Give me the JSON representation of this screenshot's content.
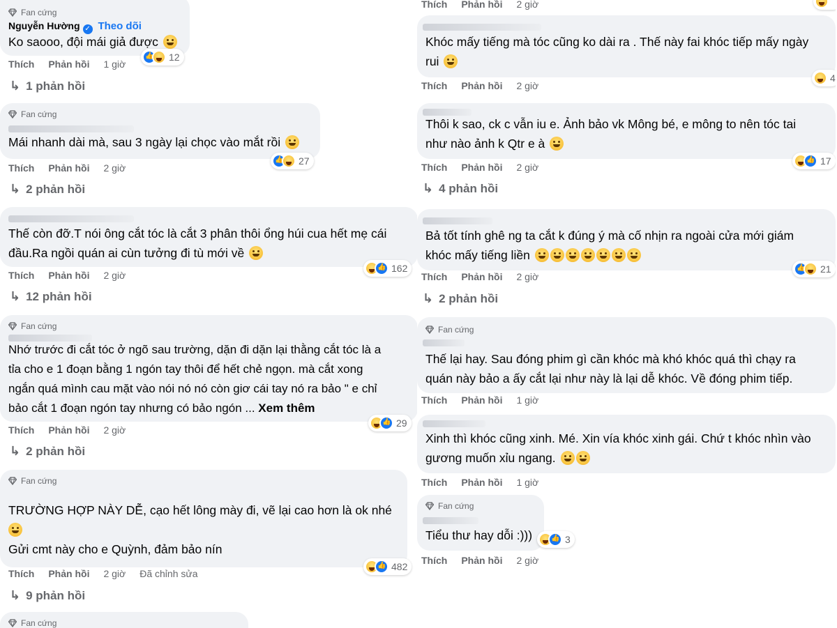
{
  "common": {
    "like": "Thích",
    "reply": "Phản hồi",
    "badge": "Fan cứng",
    "see_more": "Xem thêm",
    "follow": "Theo dõi"
  },
  "left": [
    {
      "author": "Nguyễn Hường",
      "text": "Ko saooo, đội mái giả được",
      "reactions": [
        "like",
        "haha"
      ],
      "count": "12",
      "time": "1 giờ",
      "replies": "1 phản hồi"
    },
    {
      "text": "Mái nhanh dài mà, sau 3 ngày lại chọc vào mắt rồi",
      "reactions": [
        "like",
        "haha"
      ],
      "count": "27",
      "time": "2 giờ",
      "replies": "2 phản hồi"
    },
    {
      "text_lines": [
        "Thế còn đỡ.T nói ông cắt tóc là cắt 3 phân thôi ổng húi cua hết mẹ cái",
        "đầu.Ra ngồi quán ai cùn tưởng đi tù mới về"
      ],
      "reactions": [
        "haha",
        "like"
      ],
      "count": "162",
      "time": "2 giờ",
      "replies": "12 phản hồi"
    },
    {
      "text_lines": [
        "Nhớ trước đi cắt tóc ở ngõ sau trường, dặn đi dặn lại thằng cắt tóc là a",
        "tỉa cho e 1 đoạn bằng 1 ngón tay thôi để hết chẻ ngọn. mà cắt xong",
        "ngắn quá mình cau mặt vào nói nó nó còn giơ cái tay nó ra bảo \" e chỉ",
        "bảo cắt 1 đoạn ngón tay nhưng có bảo ngón ..."
      ],
      "reactions": [
        "haha",
        "like"
      ],
      "count": "29",
      "time": "2 giờ",
      "replies": "2 phản hồi"
    },
    {
      "text_lines": [
        "TRƯỜNG HỢP NÀY DỄ, cạo hết lông mày đi, vẽ lại cao hơn là ok nhé",
        "Gửi cmt này cho e Quỳnh, đảm bảo nín"
      ],
      "reactions": [
        "haha",
        "like"
      ],
      "count": "482",
      "time": "2 giờ",
      "edited": "Đã chỉnh sửa",
      "replies": "9 phản hồi"
    }
  ],
  "right": [
    {
      "time": "2 giờ",
      "partial": true
    },
    {
      "text_lines": [
        "Khóc mấy tiếng mà tóc cũng ko dài ra . Thế này fai khóc tiếp mấy ngày",
        "rui"
      ],
      "reactions": [
        "haha"
      ],
      "count": "4",
      "time": "2 giờ"
    },
    {
      "text_lines": [
        "Thôi k sao, ck c vẫn iu e. Ảnh bảo vk Mông bé, e mông to nên tóc tai",
        "như nào ảnh k Qtr e à"
      ],
      "reactions": [
        "haha",
        "like"
      ],
      "count": "17",
      "time": "2 giờ",
      "replies": "4 phản hồi"
    },
    {
      "text_lines": [
        "Bả tốt tính ghê ng ta cắt k đúng ý mà cố nhịn ra ngoài cửa mới giám",
        "khóc mấy tiếng liền"
      ],
      "reactions": [
        "like",
        "haha"
      ],
      "count": "21",
      "time": "2 giờ",
      "replies": "2 phản hồi"
    },
    {
      "text_lines": [
        "Thế lại hay. Sau đóng phim gì cần khóc mà khó khóc quá thì chạy ra",
        "quán này bảo a ấy cắt lại như này là lại dễ khóc. Về đóng phim tiếp."
      ],
      "time": "1 giờ"
    },
    {
      "text_lines": [
        "Xinh thì khóc cũng xinh. Mé. Xin vía khóc xinh gái. Chứ t khóc nhìn vào",
        "gương muốn xỉu ngang."
      ],
      "time": "1 giờ"
    },
    {
      "text": "Tiểu thư hay dỗi :)))",
      "reactions": [
        "haha",
        "like"
      ],
      "count": "3",
      "time": "2 giờ"
    }
  ],
  "colors": {
    "bubble": "#f0f2f5",
    "secondary_text": "#65676b",
    "link_blue": "#1877f2"
  }
}
